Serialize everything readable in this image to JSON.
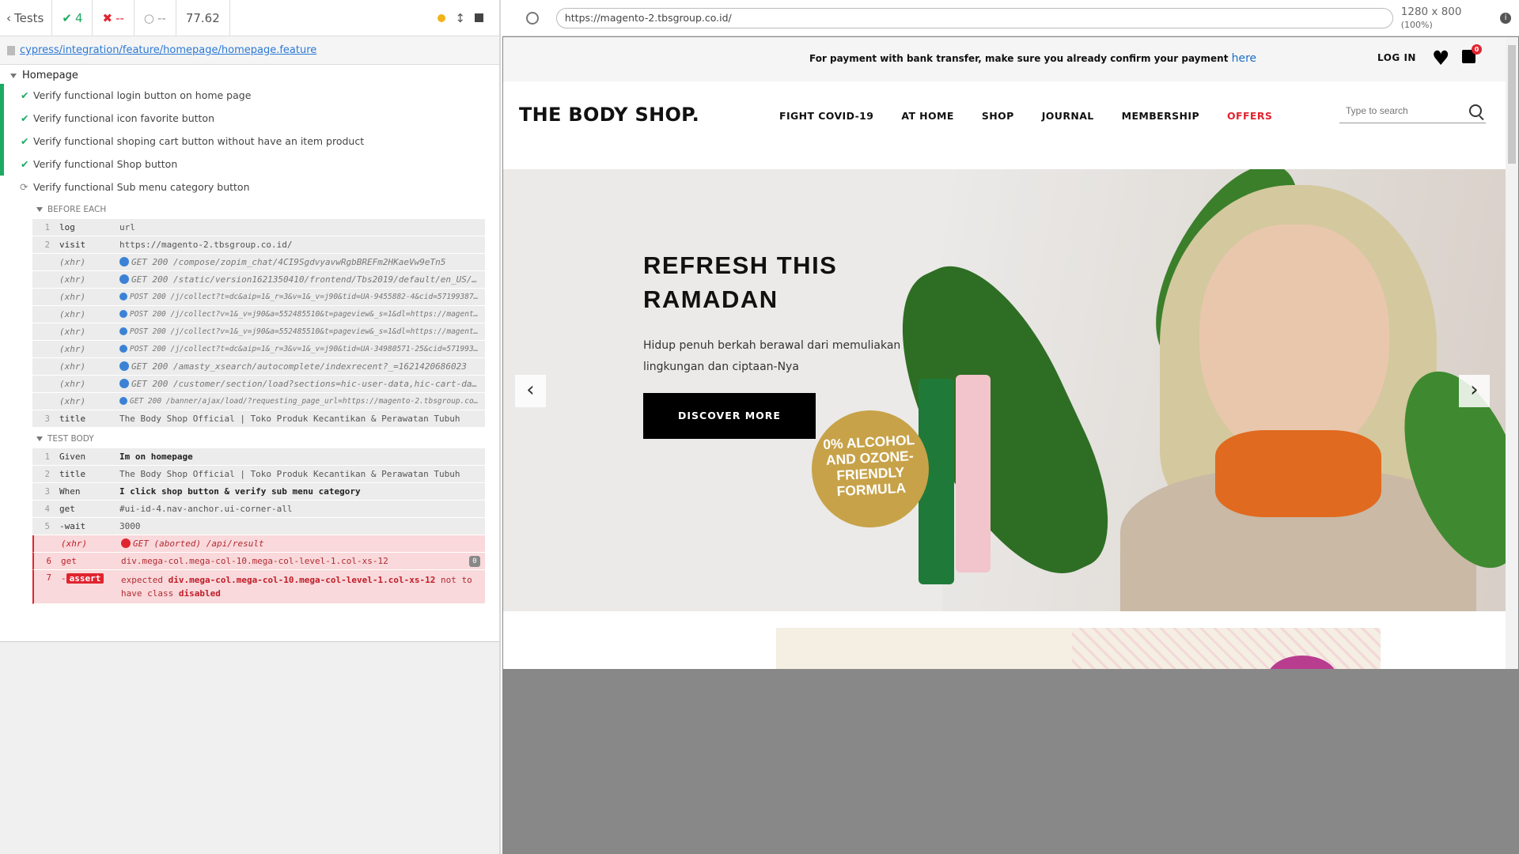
{
  "reporter": {
    "tests_label": "Tests",
    "passed": "4",
    "failed": "--",
    "pending": "--",
    "duration": "77.62",
    "spec_path": "cypress/integration/feature/homepage/homepage.feature",
    "suite": "Homepage",
    "tests": [
      {
        "title": "Verify functional login button on home page",
        "state": "passed"
      },
      {
        "title": "Verify functional icon favorite button",
        "state": "passed"
      },
      {
        "title": "Verify functional shoping cart button without have an item product",
        "state": "passed"
      },
      {
        "title": "Verify functional Shop button",
        "state": "passed"
      },
      {
        "title": "Verify functional Sub menu category button",
        "state": "running"
      }
    ],
    "before_each_label": "BEFORE EACH",
    "test_body_label": "TEST BODY",
    "before_each": [
      {
        "n": "1",
        "name": "log",
        "msg": "url"
      },
      {
        "n": "2",
        "name": "visit",
        "msg": "https://magento-2.tbsgroup.co.id/"
      },
      {
        "n": "",
        "name": "(xhr)",
        "msg": "GET 200 /compose/zopim_chat/4CI9SgdvyavwRgbBREFm2HKaeVw9eTn5"
      },
      {
        "n": "",
        "name": "(xhr)",
        "msg": "GET 200 /static/version1621350410/frontend/Tbs2019/default/en_US/..."
      },
      {
        "n": "",
        "name": "(xhr)",
        "msg": "POST 200 /j/collect?t=dc&aip=1&_r=3&v=1&_v=j90&tid=UA-9455882-4&cid=571993870..."
      },
      {
        "n": "",
        "name": "(xhr)",
        "msg": "POST 200 /j/collect?v=1&_v=j90&a=552485510&t=pageview&_s=1&dl=https://magento-..."
      },
      {
        "n": "",
        "name": "(xhr)",
        "msg": "POST 200 /j/collect?v=1&_v=j90&a=552485510&t=pageview&_s=1&dl=https://magento-..."
      },
      {
        "n": "",
        "name": "(xhr)",
        "msg": "POST 200 /j/collect?t=dc&aip=1&_r=3&v=1&_v=j90&tid=UA-34980571-25&cid=57199387..."
      },
      {
        "n": "",
        "name": "(xhr)",
        "msg": "GET 200 /amasty_xsearch/autocomplete/indexrecent?_=1621420686023"
      },
      {
        "n": "",
        "name": "(xhr)",
        "msg": "GET 200 /customer/section/load?sections=hic-user-data,hic-cart-da..."
      },
      {
        "n": "",
        "name": "(xhr)",
        "msg": "GET 200 /banner/ajax/load/?requesting_page_url=https://magento-2.tbsgroup.co.i..."
      },
      {
        "n": "3",
        "name": "title",
        "msg": "The Body Shop Official | Toko Produk Kecantikan & Perawatan Tubuh"
      }
    ],
    "body": [
      {
        "n": "1",
        "name": "Given",
        "msg": "Im on homepage"
      },
      {
        "n": "2",
        "name": "title",
        "msg": "The Body Shop Official | Toko Produk Kecantikan & Perawatan Tubuh"
      },
      {
        "n": "3",
        "name": "When",
        "msg": "I click shop button & verify sub menu category"
      },
      {
        "n": "4",
        "name": "get",
        "msg": "#ui-id-4.nav-anchor.ui-corner-all"
      },
      {
        "n": "5",
        "name": "-wait",
        "msg": "3000"
      },
      {
        "n": "",
        "name": "(xhr)",
        "msg": "GET (aborted) /api/result"
      },
      {
        "n": "6",
        "name": "get",
        "msg": "div.mega-col.mega-col-10.mega-col-level-1.col-xs-12",
        "pin": "0"
      },
      {
        "n": "7",
        "name": "-assert",
        "assert_tag": "assert",
        "msg_pre": "expected",
        "msg_sel": "div.mega-col.mega-col-10.mega-col-level-1.col-xs-12",
        "msg_mid": "not to have class",
        "msg_cls": "disabled"
      }
    ]
  },
  "aut": {
    "url": "https://magento-2.tbsgroup.co.id/",
    "viewport": "1280 x 800",
    "scale": "(100%)",
    "info": "i"
  },
  "site": {
    "notice": "For payment with bank transfer, make sure you already confirm your payment",
    "notice_link": "here",
    "login": "LOG IN",
    "cart_count": "0",
    "logo": "THE BODY SHOP.",
    "menu": [
      "FIGHT COVID-19",
      "AT HOME",
      "SHOP",
      "JOURNAL",
      "MEMBERSHIP",
      "OFFERS"
    ],
    "search_placeholder": "Type to search",
    "hero": {
      "title": "REFRESH THIS RAMADAN",
      "text": "Hidup penuh berkah berawal dari memuliakan lingkungan dan ciptaan-Nya",
      "button": "DISCOVER MORE",
      "seal": "0% ALCOHOL AND OZONE-FRIENDLY FORMULA"
    }
  },
  "colors": {
    "pass": "#1eaa63",
    "fail": "#e0242f",
    "link": "#2c79d6",
    "offers": "#e0242f"
  }
}
